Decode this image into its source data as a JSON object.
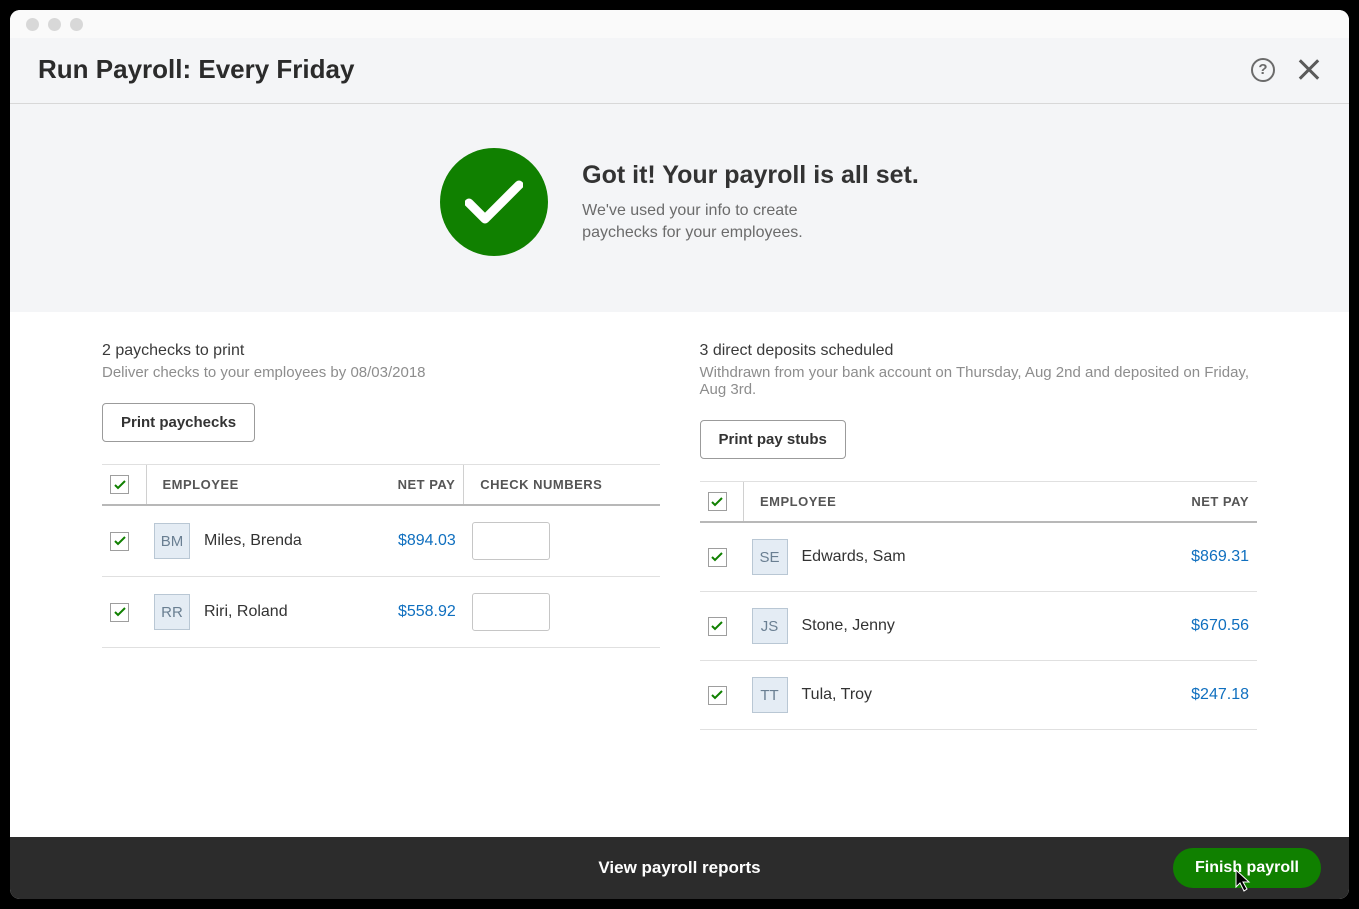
{
  "header": {
    "title": "Run Payroll: Every Friday"
  },
  "banner": {
    "heading": "Got it! Your payroll is all set.",
    "subtext": "We've used your info to create\npaychecks for your employees."
  },
  "paychecks": {
    "title": "2 paychecks to print",
    "subtitle": "Deliver checks to your employees by 08/03/2018",
    "button": "Print paychecks",
    "columns": {
      "employee": "EMPLOYEE",
      "netpay": "NET PAY",
      "checknum": "CHECK NUMBERS"
    },
    "rows": [
      {
        "initials": "BM",
        "name": "Miles, Brenda",
        "netpay": "$894.03",
        "checknum": ""
      },
      {
        "initials": "RR",
        "name": "Riri, Roland",
        "netpay": "$558.92",
        "checknum": ""
      }
    ]
  },
  "deposits": {
    "title": "3 direct deposits scheduled",
    "subtitle": "Withdrawn from your bank account on Thursday, Aug 2nd and deposited on Friday, Aug 3rd.",
    "button": "Print pay stubs",
    "columns": {
      "employee": "EMPLOYEE",
      "netpay": "NET PAY"
    },
    "rows": [
      {
        "initials": "SE",
        "name": "Edwards, Sam",
        "netpay": "$869.31"
      },
      {
        "initials": "JS",
        "name": "Stone, Jenny",
        "netpay": "$670.56"
      },
      {
        "initials": "TT",
        "name": "Tula, Troy",
        "netpay": "$247.18"
      }
    ]
  },
  "footer": {
    "reports_link": "View payroll reports",
    "finish_button": "Finish payroll"
  }
}
